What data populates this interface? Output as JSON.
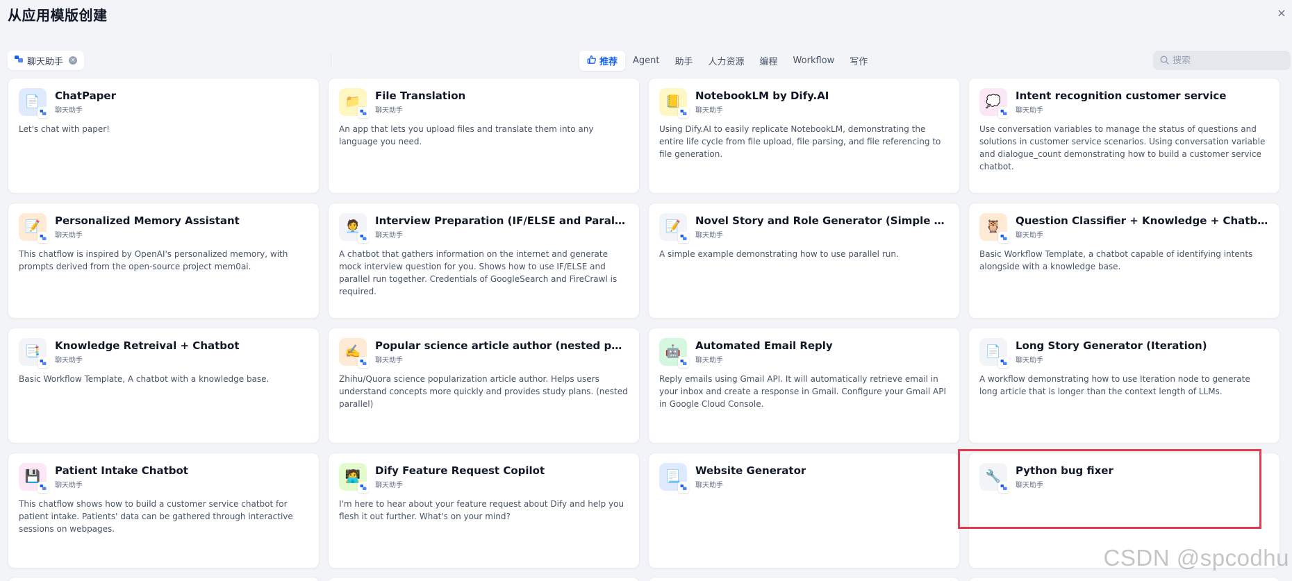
{
  "header": {
    "title": "从应用模版创建",
    "close_symbol": "×"
  },
  "filter": {
    "label": "聊天助手",
    "clear_symbol": "×"
  },
  "tabs": [
    {
      "label": "推荐",
      "active": true
    },
    {
      "label": "Agent",
      "active": false
    },
    {
      "label": "助手",
      "active": false
    },
    {
      "label": "人力资源",
      "active": false
    },
    {
      "label": "编程",
      "active": false
    },
    {
      "label": "Workflow",
      "active": false
    },
    {
      "label": "写作",
      "active": false
    }
  ],
  "search": {
    "placeholder": "搜索",
    "value": ""
  },
  "colors": {
    "accent": "#155eef",
    "highlight": "#e23b4e"
  },
  "cards": [
    {
      "name": "ChatPaper",
      "type": "聊天助手",
      "desc": "Let's chat with paper!",
      "icon": "document-icon",
      "glyph": "📄",
      "bg": "#e0eaff"
    },
    {
      "name": "File Translation",
      "type": "聊天助手",
      "desc": "An app that lets you upload files and translate them into any language you need.",
      "icon": "folder-icon",
      "glyph": "📁",
      "bg": "#fef7c3"
    },
    {
      "name": "NotebookLM by Dify.AI",
      "type": "聊天助手",
      "desc": "Using Dify.AI to easily replicate NotebookLM, demonstrating the entire life cycle from file upload, file parsing, and file referencing to file generation.",
      "icon": "notebook-icon",
      "glyph": "📒",
      "bg": "#fef7c3"
    },
    {
      "name": "Intent recognition customer service",
      "type": "聊天助手",
      "desc": "Use conversation variables to manage the status of questions and solutions in customer service scenarios. Using conversation variable and dialogue_count demonstrating how to build a customer service chatbot.",
      "icon": "chat-bubble-icon",
      "glyph": "💭",
      "bg": "#fce7f6"
    },
    {
      "name": "Personalized Memory Assistant",
      "type": "聊天助手",
      "desc": "This chatflow is inspired by OpenAI's personalized memory, with prompts derived from the open-source project mem0ai.",
      "icon": "memo-icon",
      "glyph": "📝",
      "bg": "#ffead5"
    },
    {
      "name": "Interview Preparation (IF/ELSE and Parallel Run)",
      "type": "聊天助手",
      "desc": "A chatbot that gathers information on the internet and generate mock interview question for you. Shows how to use IF/ELSE and parallel run together. Credentials of GoogleSearch and FireCrawl is required.",
      "icon": "person-icon",
      "glyph": "🧑‍💼",
      "bg": "#f2f4f7"
    },
    {
      "name": "Novel Story and Role Generator (Simple Parallel Run)",
      "type": "聊天助手",
      "desc": "A simple example demonstrating how to use parallel run.",
      "icon": "memo-icon",
      "glyph": "📝",
      "bg": "#f2f4f7"
    },
    {
      "name": "Question Classifier + Knowledge + Chatbot",
      "type": "聊天助手",
      "desc": "Basic Workflow Template, a chatbot capable of identifying intents alongside with a knowledge base.",
      "icon": "owl-icon",
      "glyph": "🦉",
      "bg": "#ffead5"
    },
    {
      "name": "Knowledge Retreival + Chatbot",
      "type": "聊天助手",
      "desc": "Basic Workflow Template, A chatbot with a knowledge base.",
      "icon": "document-icon",
      "glyph": "📑",
      "bg": "#f2f4f7"
    },
    {
      "name": "Popular science article author (nested parallel)",
      "type": "聊天助手",
      "desc": "Zhihu/Quora science popularization article author. Helps users understand concepts more quickly and provides study plans. (nested parallel)",
      "icon": "pencil-icon",
      "glyph": "✍️",
      "bg": "#ffead5"
    },
    {
      "name": "Automated Email Reply",
      "type": "聊天助手",
      "desc": "Reply emails using Gmail API. It will automatically retrieve email in your inbox and create a response in Gmail. Configure your Gmail API in Google Cloud Console.",
      "icon": "robot-icon",
      "glyph": "🤖",
      "bg": "#d3f8df"
    },
    {
      "name": "Long Story Generator (Iteration)",
      "type": "聊天助手",
      "desc": "A workflow demonstrating how to use Iteration node to generate long article that is longer than the context length of LLMs.",
      "icon": "document-icon",
      "glyph": "📄",
      "bg": "#f2f4f7"
    },
    {
      "name": "Patient Intake Chatbot",
      "type": "聊天助手",
      "desc": "This chatflow shows how to build a customer service chatbot for patient intake. Patients' data can be gathered through interactive sessions on webpages.",
      "icon": "floppy-disk-icon",
      "glyph": "💾",
      "bg": "#fce7f6"
    },
    {
      "name": "Dify Feature Request Copilot",
      "type": "聊天助手",
      "desc": "I'm here to hear about your feature request about Dify and help you flesh it out further. What's on your mind?",
      "icon": "person-icon",
      "glyph": "🧑‍💻",
      "bg": "#e3fbcc"
    },
    {
      "name": "Website Generator",
      "type": "聊天助手",
      "desc": "",
      "icon": "document-icon",
      "glyph": "📃",
      "bg": "#e0eaff"
    },
    {
      "name": "Python bug fixer",
      "type": "聊天助手",
      "desc": "",
      "icon": "wrench-icon",
      "glyph": "🔧",
      "bg": "#f2f4f7",
      "highlighted": true
    }
  ],
  "watermark": "CSDN @spcodhu"
}
